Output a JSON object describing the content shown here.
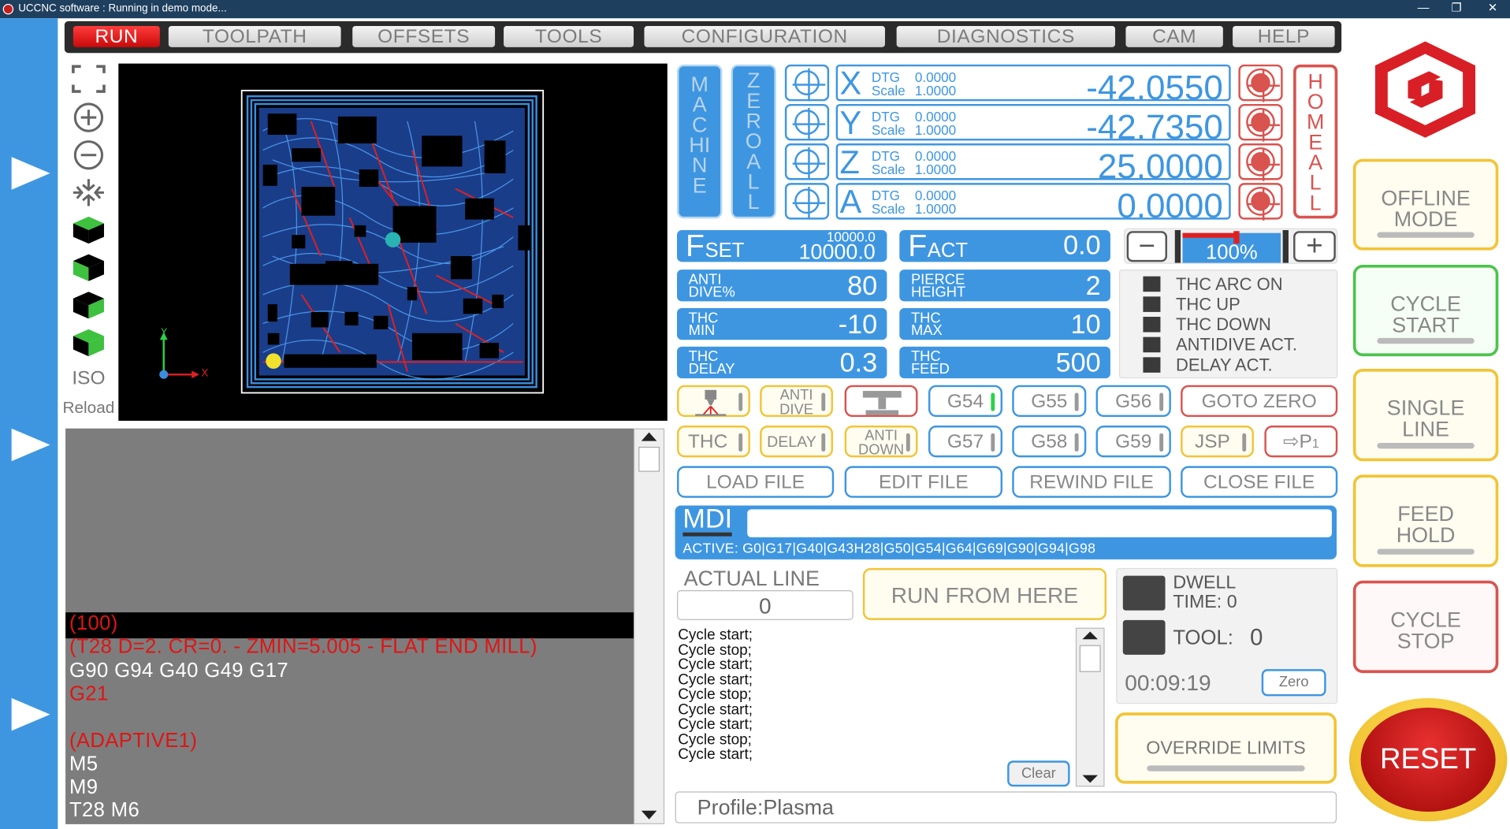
{
  "window": {
    "title": "UCCNC software : Running in demo mode...",
    "controls": [
      "minimize-icon",
      "restore-icon",
      "close-icon"
    ]
  },
  "menu": {
    "tabs": [
      "RUN",
      "TOOLPATH",
      "OFFSETS",
      "TOOLS",
      "CONFIGURATION",
      "DIAGNOSTICS",
      "CAM",
      "HELP"
    ],
    "active": "RUN"
  },
  "viewer_tools": {
    "iso_label": "ISO",
    "reload_label": "Reload",
    "axis_y": "Y",
    "axis_x": "X"
  },
  "gcode": {
    "lines": [
      {
        "text": "(100)",
        "red": true,
        "highlight": true
      },
      {
        "text": "(T28  D=2. CR=0. - ZMIN=5.005 - FLAT END MILL)",
        "red": true
      },
      {
        "text": "G90 G94 G40 G49 G17",
        "red": false
      },
      {
        "text": "G21",
        "red": true
      },
      {
        "text": "",
        "red": false
      },
      {
        "text": "(ADAPTIVE1)",
        "red": true
      },
      {
        "text": "M5",
        "red": false
      },
      {
        "text": "M9",
        "red": false
      },
      {
        "text": "T28 M6",
        "red": false
      }
    ]
  },
  "dro": {
    "machine_label": "MACHINE",
    "zero_all_label": "ZERO ALL",
    "home_all_label": "HOME ALL",
    "axes": [
      {
        "letter": "X",
        "dtg_label": "DTG",
        "dtg": "0.0000",
        "scale_label": "Scale",
        "scale": "1.0000",
        "value": "-42.0550"
      },
      {
        "letter": "Y",
        "dtg_label": "DTG",
        "dtg": "0.0000",
        "scale_label": "Scale",
        "scale": "1.0000",
        "value": "-42.7350"
      },
      {
        "letter": "Z",
        "dtg_label": "DTG",
        "dtg": "0.0000",
        "scale_label": "Scale",
        "scale": "1.0000",
        "value": "25.0000"
      },
      {
        "letter": "A",
        "dtg_label": "DTG",
        "dtg": "0.0000",
        "scale_label": "Scale",
        "scale": "1.0000",
        "value": "0.0000"
      }
    ]
  },
  "feed": {
    "fset_label": "F",
    "fset_sub": "SET",
    "fset_top": "10000.0",
    "fset_value": "10000.0",
    "fact_label": "F",
    "fact_sub": "ACT",
    "fact_value": "0.0",
    "override_percent": "100%",
    "override_fraction": 0.55
  },
  "thc_params": [
    {
      "label1": "ANTI",
      "label2": "DIVE%",
      "value": "80"
    },
    {
      "label1": "PIERCE",
      "label2": "HEIGHT",
      "value": "2"
    },
    {
      "label1": "THC",
      "label2": "MIN",
      "value": "-10"
    },
    {
      "label1": "THC",
      "label2": "MAX",
      "value": "10"
    },
    {
      "label1": "THC",
      "label2": "DELAY",
      "value": "0.3"
    },
    {
      "label1": "THC",
      "label2": "FEED",
      "value": "500"
    }
  ],
  "thc_leds": [
    "THC ARC ON",
    "THC UP",
    "THC DOWN",
    "ANTIDIVE ACT.",
    "DELAY ACT."
  ],
  "buttons_row1": {
    "anti_dive_1": "ANTI",
    "anti_dive_2": "DIVE",
    "g54": "G54",
    "g55": "G55",
    "g56": "G56",
    "goto_zero": "GOTO ZERO"
  },
  "buttons_row2": {
    "thc": "THC",
    "delay": "DELAY",
    "anti_down_1": "ANTI",
    "anti_down_2": "DOWN",
    "g57": "G57",
    "g58": "G58",
    "g59": "G59",
    "jsp": "JSP",
    "p1": "P",
    "p1_sub": "1"
  },
  "file_buttons": [
    "LOAD FILE",
    "EDIT FILE",
    "REWIND FILE",
    "CLOSE FILE"
  ],
  "mdi": {
    "label": "MDI",
    "value": "",
    "active": "ACTIVE: G0|G17|G40|G43H28|G50|G54|G64|G69|G90|G94|G98"
  },
  "actual_line": {
    "label": "ACTUAL LINE",
    "value": "0",
    "run_from_here": "RUN FROM HERE"
  },
  "status": {
    "dwell_label1": "DWELL",
    "dwell_label2": "TIME:",
    "dwell_value": "0",
    "tool_label": "TOOL:",
    "tool_value": "0",
    "timer": "00:09:19",
    "zero_label": "Zero",
    "override_limits": "OVERRIDE LIMITS"
  },
  "log": {
    "lines": [
      "Cycle start;",
      "Cycle stop;",
      "Cycle start;",
      "Cycle start;",
      "Cycle stop;",
      "Cycle start;",
      "Cycle start;",
      "Cycle stop;",
      "Cycle start;"
    ],
    "clear_label": "Clear"
  },
  "profile": "Profile:Plasma",
  "side_buttons": [
    {
      "l1": "OFFLINE",
      "l2": "MODE",
      "color": "#f2c436"
    },
    {
      "l1": "CYCLE",
      "l2": "START",
      "color": "#4cc44c"
    },
    {
      "l1": "SINGLE",
      "l2": "LINE",
      "color": "#f2c436"
    },
    {
      "l1": "FEED",
      "l2": "HOLD",
      "color": "#f2c436"
    },
    {
      "l1": "CYCLE",
      "l2": "STOP",
      "color": "#d9534f"
    }
  ],
  "reset_label": "RESET",
  "colors": {
    "accent": "#3e96e1",
    "red": "#d9534f",
    "yellow": "#f2c436",
    "green": "#4cc44c"
  }
}
